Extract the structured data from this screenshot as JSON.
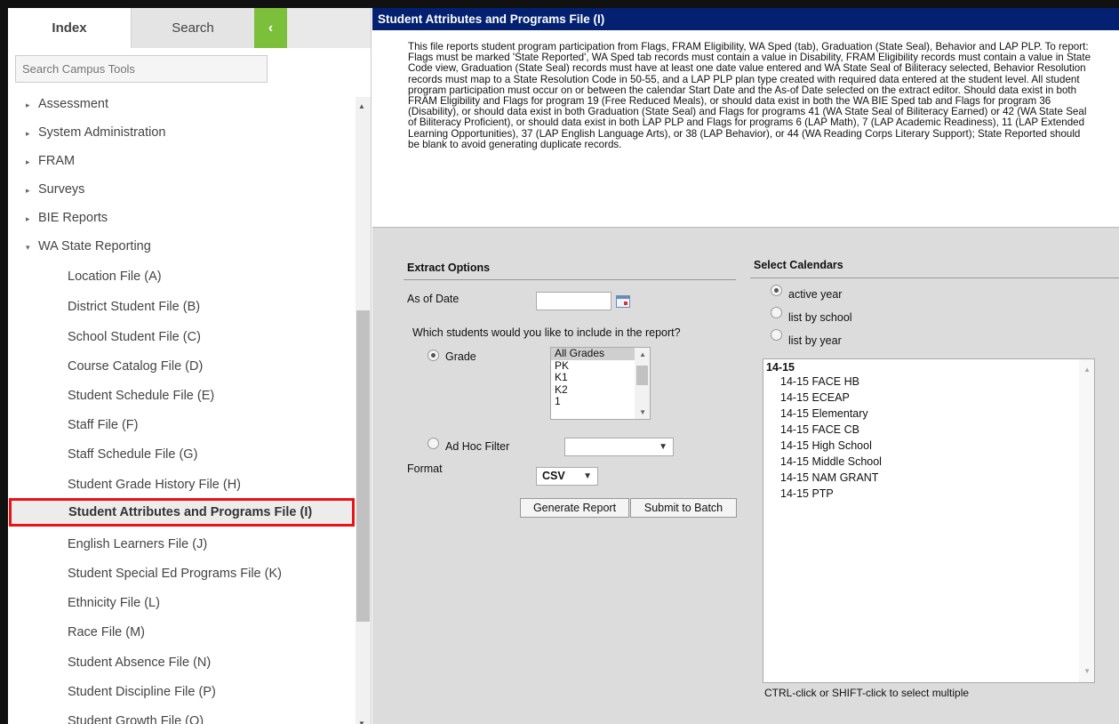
{
  "sidebar": {
    "tabs": {
      "index": "Index",
      "search": "Search",
      "collapse": "‹"
    },
    "search_placeholder": "Search Campus Tools",
    "items": [
      {
        "label": "Assessment",
        "arrow": "▸",
        "kind": "top"
      },
      {
        "label": "System Administration",
        "arrow": "▸",
        "kind": "top"
      },
      {
        "label": "FRAM",
        "arrow": "▸",
        "kind": "top"
      },
      {
        "label": "Surveys",
        "arrow": "▸",
        "kind": "top"
      },
      {
        "label": "BIE Reports",
        "arrow": "▸",
        "kind": "top"
      },
      {
        "label": "WA State Reporting",
        "arrow": "▾",
        "kind": "top"
      },
      {
        "label": "Location File (A)",
        "kind": "sub"
      },
      {
        "label": "District Student File (B)",
        "kind": "sub"
      },
      {
        "label": "School Student File (C)",
        "kind": "sub"
      },
      {
        "label": "Course Catalog File (D)",
        "kind": "sub"
      },
      {
        "label": "Student Schedule File (E)",
        "kind": "sub"
      },
      {
        "label": "Staff File (F)",
        "kind": "sub"
      },
      {
        "label": "Staff Schedule File (G)",
        "kind": "sub"
      },
      {
        "label": "Student Grade History File (H)",
        "kind": "sub"
      },
      {
        "label": "Student Attributes and Programs File (I)",
        "kind": "sub",
        "selected": true
      },
      {
        "label": "English Learners File (J)",
        "kind": "sub"
      },
      {
        "label": "Student Special Ed Programs File (K)",
        "kind": "sub"
      },
      {
        "label": "Ethnicity File (L)",
        "kind": "sub"
      },
      {
        "label": "Race File (M)",
        "kind": "sub"
      },
      {
        "label": "Student Absence File (N)",
        "kind": "sub"
      },
      {
        "label": "Student Discipline File (P)",
        "kind": "sub"
      },
      {
        "label": "Student Growth File (Q)",
        "kind": "sub"
      }
    ]
  },
  "main": {
    "title": "Student Attributes and Programs File (I)",
    "description": "This file reports student program participation from Flags, FRAM Eligibility, WA Sped (tab), Graduation (State Seal), Behavior and LAP PLP. To report: Flags must be marked 'State Reported', WA Sped tab records must contain a value in Disability, FRAM Eligibility records must contain a value in State Code view, Graduation (State Seal) records must have at least one date value entered and WA State Seal of Biliteracy selected, Behavior Resolution records must map to a State Resolution Code in 50-55, and a LAP PLP plan type created with required data entered at the student level. All student program participation must occur on or between the calendar Start Date and the As-of Date selected on the extract editor. Should data exist in both FRAM Eligibility and Flags for program 19 (Free Reduced Meals), or should data exist in both the WA BIE Sped tab and Flags for program 36 (Disability), or should data exist in both Graduation (State Seal) and Flags for programs 41 (WA State Seal of Biliteracy Earned) or 42 (WA State Seal of Biliteracy Proficient), or should data exist in both LAP PLP and Flags for programs 6 (LAP Math), 7 (LAP Academic Readiness), 11 (LAP Extended Learning Opportunities), 37 (LAP English Language Arts), or 38 (LAP Behavior), or 44 (WA Reading Corps Literary Support); State Reported should be blank to avoid generating duplicate records."
  },
  "extract": {
    "title": "Extract Options",
    "as_of_date_label": "As of Date",
    "as_of_date_value": "",
    "students_question": "Which students would you like to include in the report?",
    "grade_label": "Grade",
    "grade_options": [
      "All Grades",
      "PK",
      "K1",
      "K2",
      "1"
    ],
    "adhoc_label": "Ad Hoc Filter",
    "adhoc_value": "",
    "format_label": "Format",
    "format_value": "CSV",
    "generate_label": "Generate Report",
    "batch_label": "Submit to Batch"
  },
  "calendars": {
    "title": "Select Calendars",
    "options": [
      "active year",
      "list by school",
      "list by year"
    ],
    "group": "14-15",
    "items": [
      "14-15 FACE HB",
      "14-15 ECEAP",
      "14-15 Elementary",
      "14-15 FACE CB",
      "14-15 High School",
      "14-15 Middle School",
      "14-15 NAM GRANT",
      "14-15 PTP"
    ],
    "hint": "CTRL-click or SHIFT-click to select multiple"
  }
}
